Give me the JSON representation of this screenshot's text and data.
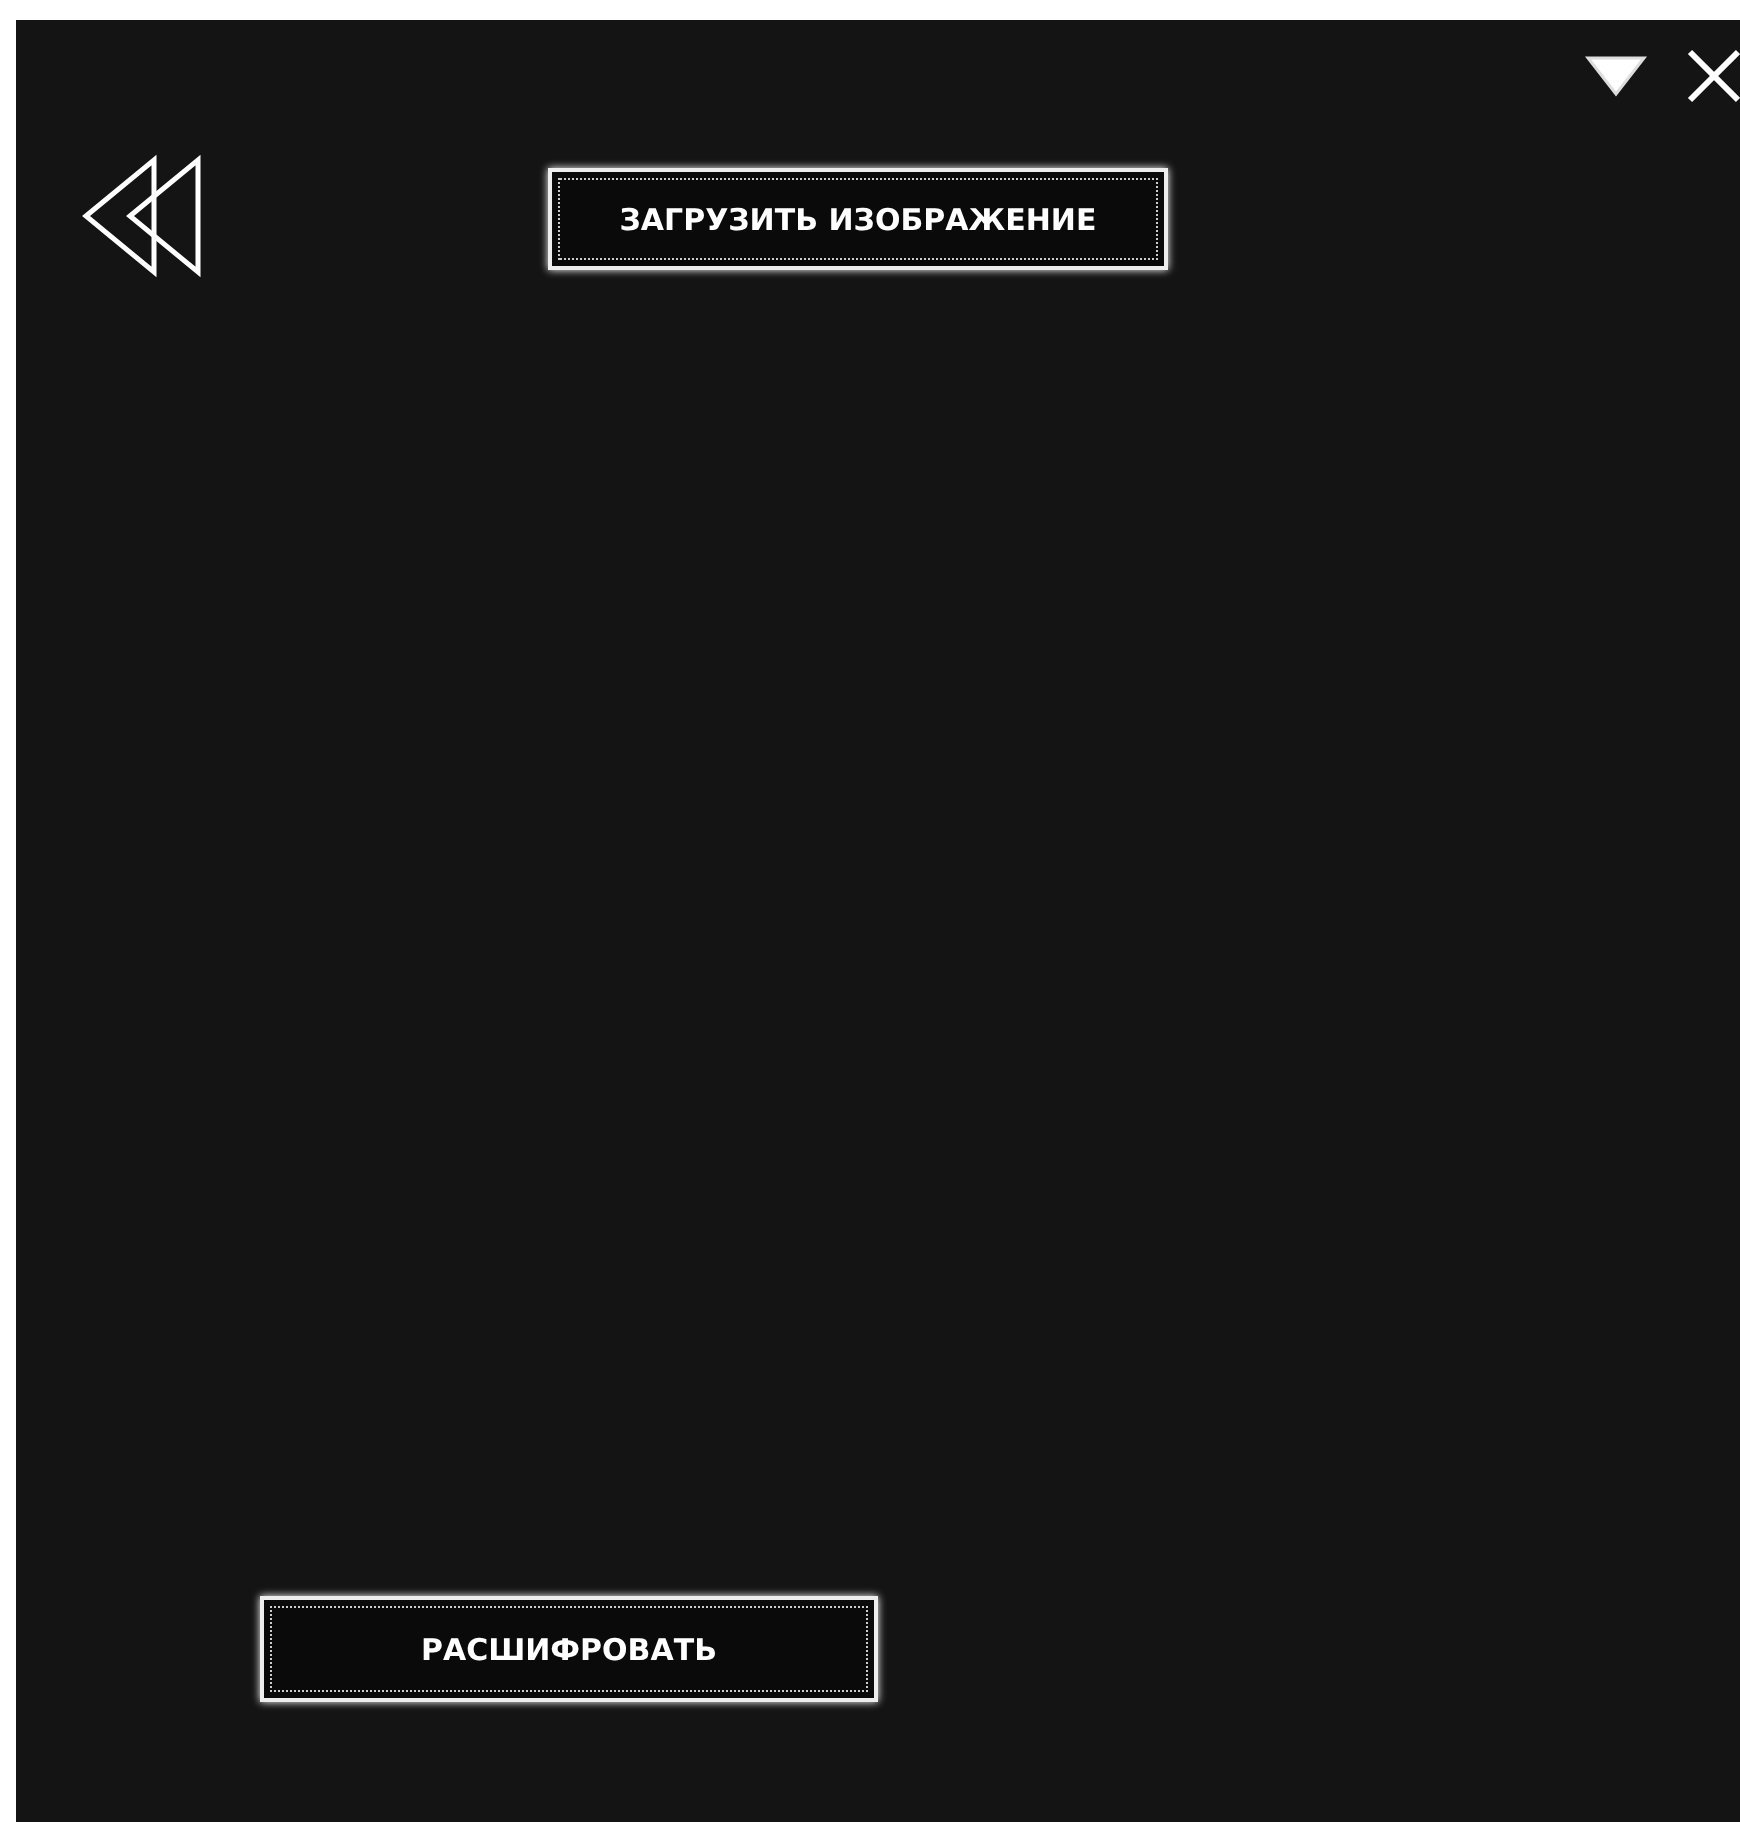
{
  "upload_button": {
    "label": "ЗАГРУЗИТЬ ИЗОБРАЖЕНИЕ"
  },
  "decrypt_button": {
    "label": "РАСШИФРОВАТЬ"
  }
}
